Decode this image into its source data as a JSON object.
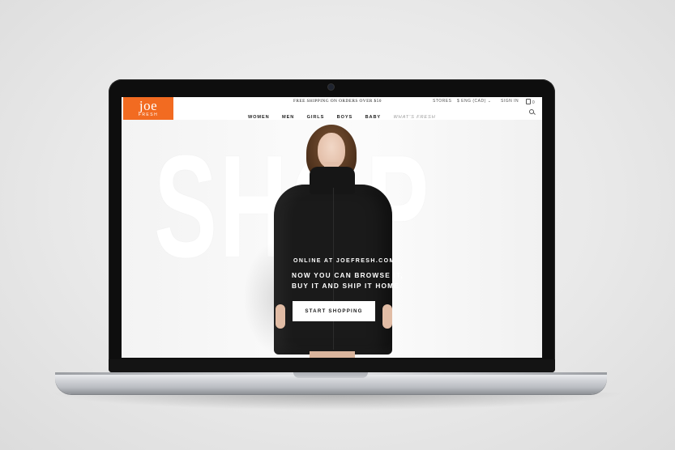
{
  "header": {
    "logo": {
      "main": "joe",
      "sub": "FRESH"
    },
    "promo": "FREE SHIPPING ON ORDERS OVER $50",
    "utility": {
      "stores": "STORES",
      "currency": "ENG (CAD)",
      "currency_symbol": "$",
      "signin": "SIGN IN",
      "bag_count": "0"
    },
    "nav": [
      "WOMEN",
      "MEN",
      "GIRLS",
      "BOYS",
      "BABY",
      "WHAT'S FRESH"
    ]
  },
  "hero": {
    "background_word": "SHOP",
    "eyebrow": "ONLINE AT JOEFRESH.COM",
    "headline_line1": "NOW YOU CAN BROWSE IT,",
    "headline_line2": "BUY IT AND SHIP IT HOME",
    "cta_label": "START SHOPPING"
  },
  "colors": {
    "brand": "#f26b21",
    "text": "#222222",
    "hero_text": "#ffffff"
  },
  "icons": [
    "search-icon",
    "bag-icon",
    "chevron-down-icon"
  ]
}
